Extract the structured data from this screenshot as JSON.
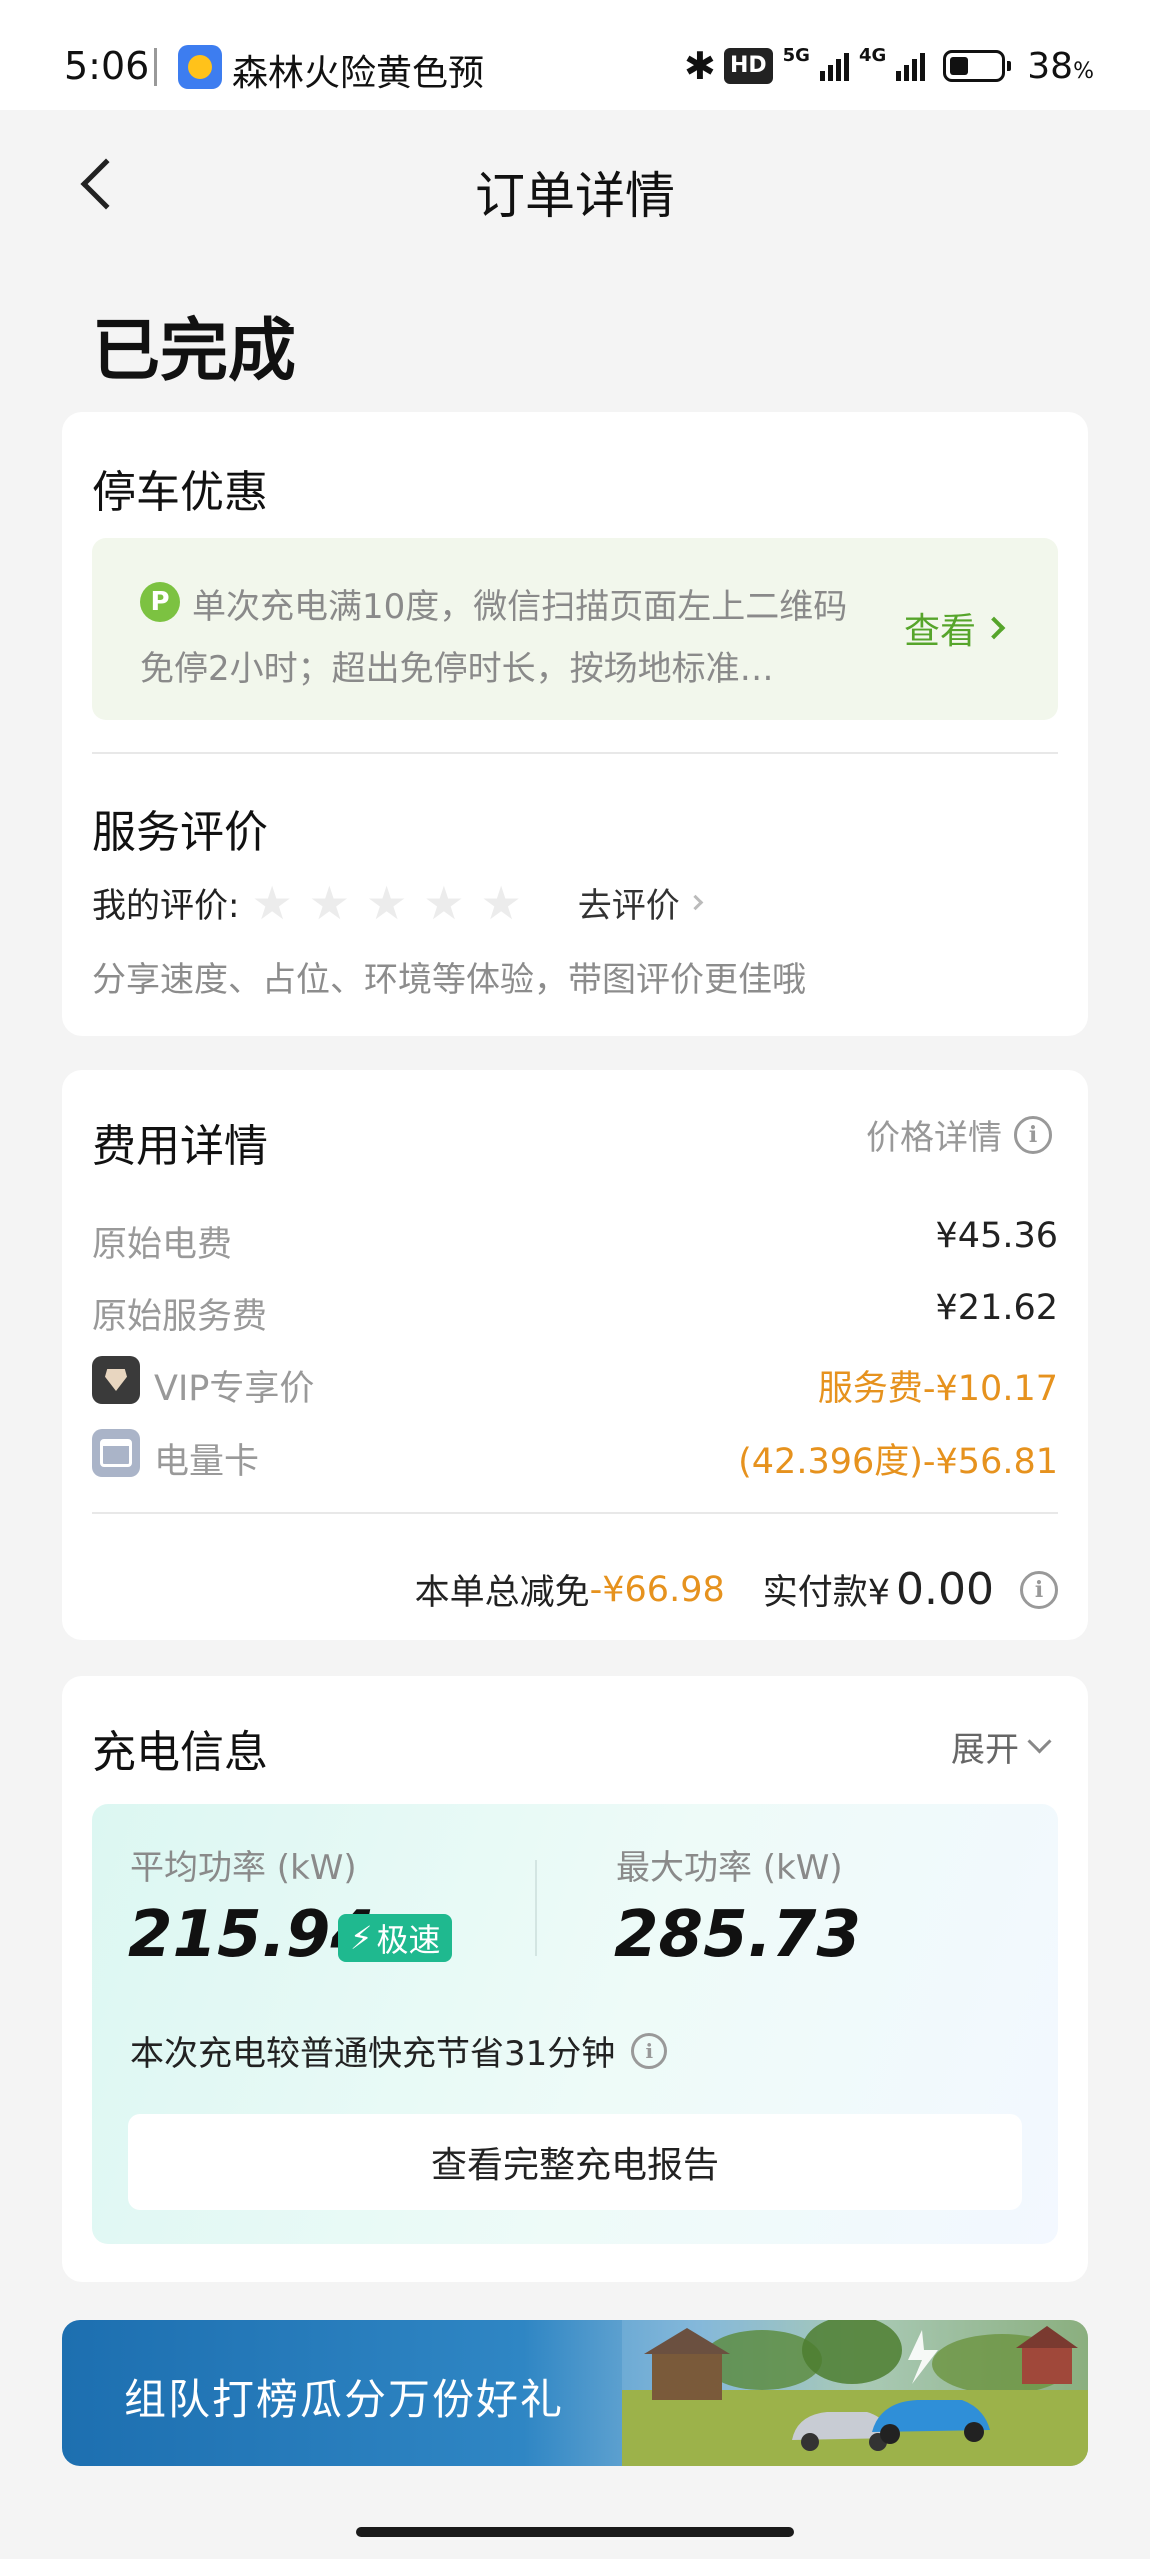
{
  "status_bar": {
    "time": "5:06",
    "notification_text": "森林火险黄色预",
    "hd_label": "HD",
    "net_5g": "5G",
    "net_4g": "4G",
    "battery_pct": "38",
    "battery_unit": "%"
  },
  "nav": {
    "title": "订单详情"
  },
  "order_status": "已完成",
  "parking": {
    "title": "停车优惠",
    "icon_letter": "P",
    "text": "单次充电满10度，微信扫描页面左上二维码免停2小时；超出免停时长，按场地标准…",
    "link": "查看"
  },
  "rating": {
    "title": "服务评价",
    "label": "我的评价:",
    "stars": 0,
    "star_max": 5,
    "action": "去评价",
    "hint": "分享速度、占位、环境等体验，带图评价更佳哦"
  },
  "fees": {
    "title": "费用详情",
    "price_detail": "价格详情",
    "items": [
      {
        "label": "原始电费",
        "value": "¥45.36"
      },
      {
        "label": "原始服务费",
        "value": "¥21.62"
      },
      {
        "label": "VIP专享价",
        "value": "服务费-¥10.17"
      },
      {
        "label": "电量卡",
        "value": "(42.396度)-¥56.81"
      }
    ],
    "total_discount_label": "本单总减免",
    "total_discount": "-¥66.98",
    "paid_label": "实付款¥",
    "paid": "0.00"
  },
  "charging": {
    "title": "充电信息",
    "expand": "展开",
    "avg_power_label": "平均功率 (kW)",
    "avg_power": "215.94",
    "speed_badge": "极速",
    "max_power_label": "最大功率 (kW)",
    "max_power": "285.73",
    "saving_text": "本次充电较普通快充节省31分钟",
    "report_button": "查看完整充电报告"
  },
  "banner": {
    "text": "组队打榜瓜分万份好礼"
  },
  "colors": {
    "accent_orange": "#e6921e",
    "accent_green": "#56a52b",
    "speed_green": "#1fb98f"
  }
}
